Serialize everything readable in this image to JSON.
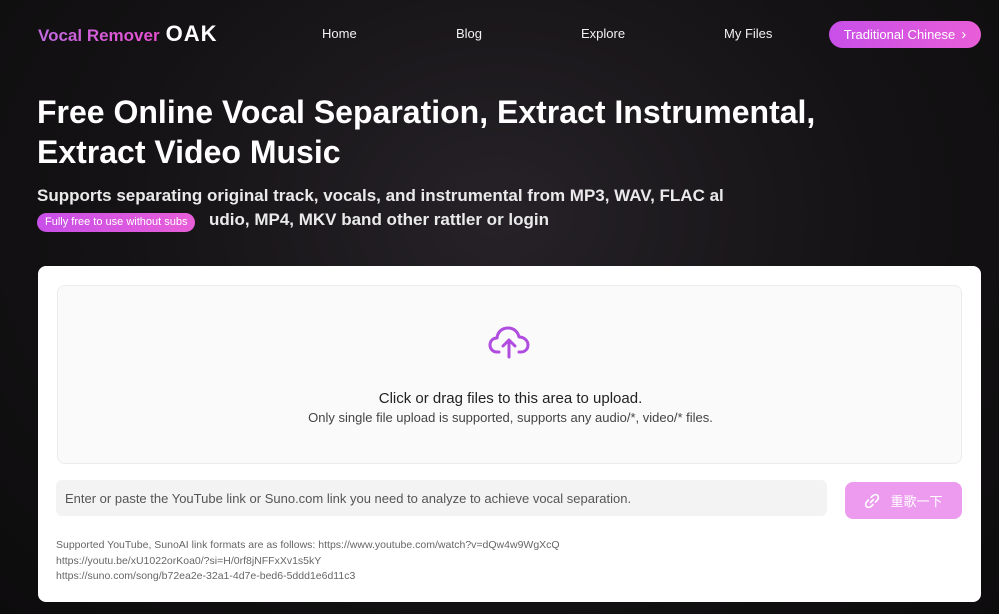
{
  "nav": {
    "logo_text": "Vocal Remover",
    "logo_brand": "OAK",
    "links": [
      "Home",
      "Blog",
      "Explore",
      "My Files"
    ],
    "language_button": "Traditional Chinese",
    "language_chevron": "›"
  },
  "hero": {
    "title_line1": "Free Online Vocal Separation, Extract Instrumental,",
    "title_line2": "Extract Video Music",
    "subtitle_line1": "Supports separating original track, vocals, and instrumental from MP3, WAV, FLAC al",
    "subtitle_line2": "udio, MP4, MKV band other rattler or login",
    "free_badge": "Fully free to use without subs"
  },
  "upload": {
    "icon": "cloud-upload-icon",
    "main_text": "Click or drag files to this area to upload.",
    "hint_text": "Only single file upload is supported, supports any audio/*, video/* files."
  },
  "link_form": {
    "placeholder": "Enter or paste the YouTube link or Suno.com link you need to analyze to achieve vocal separation.",
    "value": "",
    "submit_label": "重歌一下",
    "submit_icon": "link-icon"
  },
  "formats": {
    "line1": "Supported YouTube, SunoAI link formats are as follows: https://www.youtube.com/watch?v=dQw4w9WgXcQ",
    "line2": "https://youtu.be/xU1022orKoa0/?si=H/0rf8jNFFxXv1s5kY",
    "line3": "https://suno.com/song/b72ea2e-32a1-4d7e-bed6-5ddd1e6d11c3"
  },
  "colors": {
    "accent_start": "#c84fe8",
    "accent_end": "#e85ed8",
    "submit_bg": "#ec9bef",
    "upload_icon": "#b04ce0"
  }
}
